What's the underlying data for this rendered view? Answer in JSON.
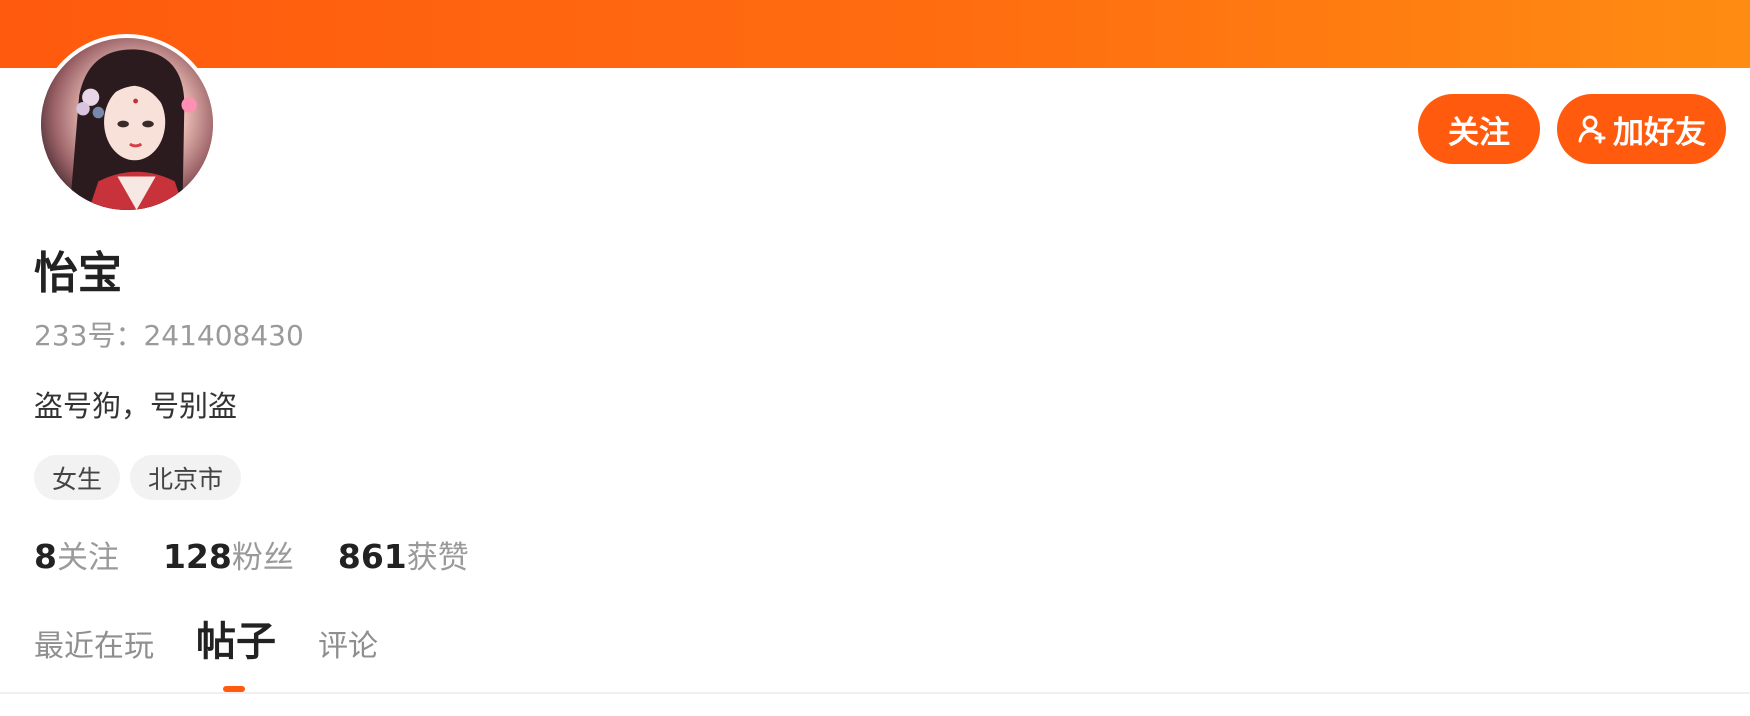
{
  "theme": {
    "accent": "#ff5a0e",
    "banner_gradient": [
      "#ff5a0e",
      "#ff8c12"
    ]
  },
  "profile": {
    "name": "怡宝",
    "id_text": "233号：241408430",
    "bio": "盗号狗，号别盗",
    "tags": [
      "女生",
      "北京市"
    ]
  },
  "actions": {
    "follow_label": "关注",
    "add_friend_label": "加好友",
    "add_friend_icon": "user-add-icon"
  },
  "stats": [
    {
      "value": "8",
      "label": "关注"
    },
    {
      "value": "128",
      "label": "粉丝"
    },
    {
      "value": "861",
      "label": "获赞"
    }
  ],
  "tabs": [
    {
      "label": "最近在玩",
      "active": false
    },
    {
      "label": "帖子",
      "active": true
    },
    {
      "label": "评论",
      "active": false
    }
  ]
}
